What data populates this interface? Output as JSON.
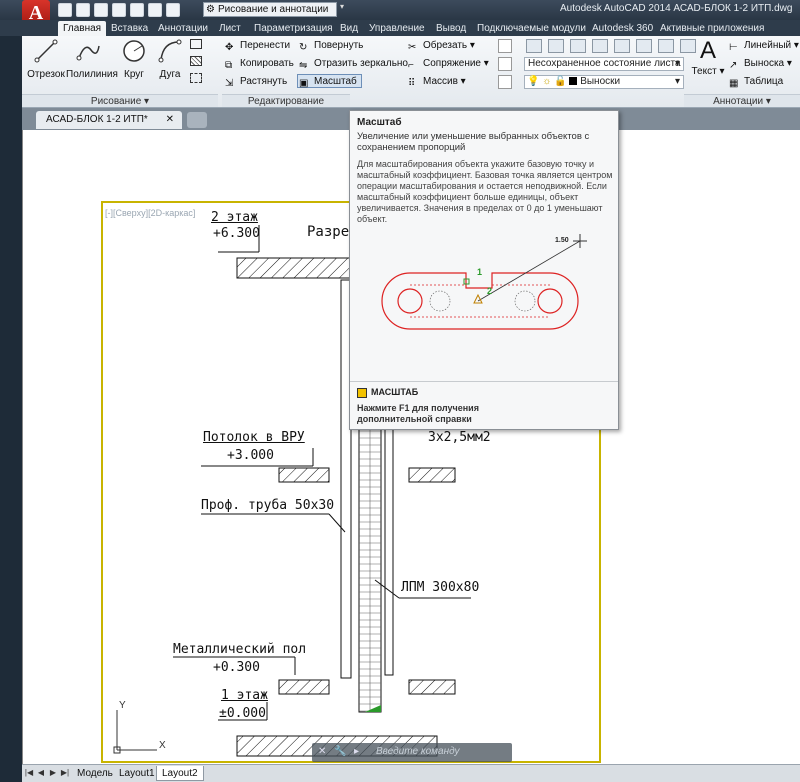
{
  "app": {
    "logo_letter": "A",
    "title": "Autodesk AutoCAD 2014    АСАD-БЛОК 1-2 ИТП.dwg",
    "workspace": "Рисование и аннотации"
  },
  "ribbon_tabs": [
    "Главная",
    "Вставка",
    "Аннотации",
    "Лист",
    "Параметризация",
    "Вид",
    "Управление",
    "Вывод",
    "Подключаемые модули",
    "Autodesk 360",
    "Активные приложения"
  ],
  "draw_panel": {
    "title": "Рисование",
    "tools": [
      "Отрезок",
      "Полилиния",
      "Круг",
      "Дуга"
    ]
  },
  "modify_panel": {
    "title": "Редактирование",
    "col1": [
      "Перенести",
      "Копировать",
      "Растянуть"
    ],
    "col2": [
      "Повернуть",
      "Отразить зеркально",
      "Масштаб"
    ],
    "col3": [
      "Обрезать",
      "Сопряжение",
      "Массив"
    ]
  },
  "layers_panel": {
    "state_combo": "Несохраненное состояние листа",
    "layer_combo": "Выноски"
  },
  "annotation_panel": {
    "title": "Аннотации",
    "text_label": "Текст",
    "items": [
      "Линейный",
      "Выноска",
      "Таблица"
    ],
    "text_icon": "A"
  },
  "document": {
    "tab_label": "АСАD-БЛОК 1-2 ИТП*",
    "viewport_label": "[-][Сверху][2D-каркас]"
  },
  "tooltip": {
    "title": "Масштаб",
    "description": "Увеличение или уменьшение выбранных объектов с сохранением пропорций",
    "body": "Для масштабирования объекта укажите базовую точку и масштабный коэффициент. Базовая точка является центром операции масштабирования и остается неподвижной. Если масштабный коэффициент больше единицы, объект увеличивается. Значения в пределах от 0 до 1 уменьшают объект.",
    "figure_scale": "1.50",
    "point1": "1",
    "point2": "2",
    "command": "МАСШТАБ",
    "help": "Нажмите F1 для получения дополнительной справки"
  },
  "drawing_labels": {
    "floor2": "2 этаж",
    "floor2_level": "+6.300",
    "section": "Разрез",
    "ceiling": "Потолок в ВРУ",
    "ceiling_level": "+3.000",
    "cable": "3x2,5мм2",
    "pipe": "Проф. труба 50х30",
    "lpm": "ЛПМ 300х80",
    "metal_floor": "Металлический пол",
    "metal_level": "+0.300",
    "floor1": "1 этаж",
    "floor1_level": "±0.000"
  },
  "ucs": {
    "x": "X",
    "y": "Y"
  },
  "command_line": {
    "placeholder": "Введите команду"
  },
  "layout_tabs": [
    "Модель",
    "Layout1",
    "Layout2"
  ]
}
